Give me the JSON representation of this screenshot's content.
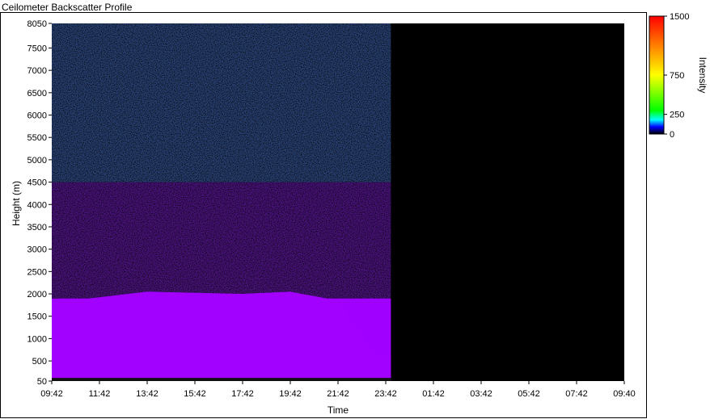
{
  "window": {
    "title": "Ceilometer Backscatter Profile"
  },
  "chart_data": {
    "type": "heatmap",
    "title": "Ceilometer Backscatter Profile",
    "xlabel": "Time",
    "ylabel": "Height (m)",
    "x_ticks": [
      "09:42",
      "11:42",
      "13:42",
      "15:42",
      "17:42",
      "19:42",
      "21:42",
      "23:42",
      "01:42",
      "03:42",
      "05:42",
      "07:42",
      "09:40"
    ],
    "y_ticks": [
      50,
      500,
      1000,
      1500,
      2000,
      2500,
      3000,
      3500,
      4000,
      4500,
      5000,
      5500,
      6000,
      6500,
      7000,
      7500,
      8050
    ],
    "ylim": [
      50,
      8050
    ],
    "data_end_time": "23:55",
    "colorbar": {
      "label": "Intensity",
      "ticks": [
        0,
        250,
        750,
        1500
      ],
      "range": [
        0,
        1500
      ],
      "colors": [
        "#000000",
        "#0000ff",
        "#00ffff",
        "#00ff00",
        "#ffff00",
        "#ff8000",
        "#ff0000"
      ]
    },
    "layers": [
      {
        "description_height_m": [
          50,
          1900
        ],
        "intensity": 5,
        "color": "#9f00ff"
      },
      {
        "description_height_m": [
          1900,
          4500
        ],
        "intensity": 3,
        "color": "#8a22e8"
      },
      {
        "description_height_m": [
          4500,
          8050
        ],
        "intensity": 2,
        "color": "#4a78d6"
      }
    ]
  }
}
